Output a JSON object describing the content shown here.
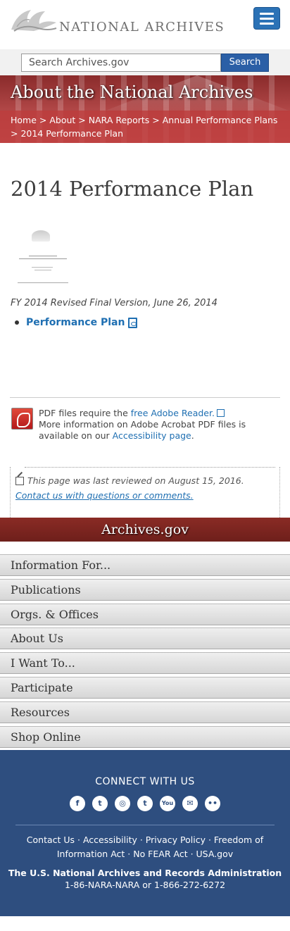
{
  "header": {
    "logo_text": "NATIONAL ARCHIVES",
    "menu_label": "Menu"
  },
  "search": {
    "placeholder": "Search Archives.gov",
    "button": "Search"
  },
  "banner": {
    "title": "About the National Archives",
    "breadcrumbs": [
      "Home",
      "About",
      "NARA Reports",
      "Annual Performance Plans",
      "2014 Performance Plan"
    ]
  },
  "main": {
    "title": "2014 Performance Plan",
    "caption": "FY 2014 Revised Final Version, June 26, 2014",
    "link_label": "Performance Plan"
  },
  "adobe": {
    "text1": "PDF files require the ",
    "link1": "free Adobe Reader.",
    "text2": "More information on Adobe Acrobat PDF files is available on our ",
    "link2": "Accessibility page",
    "text3": "."
  },
  "review": {
    "reviewed": "This page was last reviewed on August 15, 2016.",
    "contact": "Contact us with questions or comments."
  },
  "site_bar": "Archives.gov",
  "nav": [
    "Information For...",
    "Publications",
    "Orgs. & Offices",
    "About Us",
    "I Want To...",
    "Participate",
    "Resources",
    "Shop Online"
  ],
  "footer": {
    "connect": "CONNECT WITH US",
    "social": [
      "f",
      "t",
      "◎",
      "t",
      "You",
      "✉",
      "••"
    ],
    "links": "Contact Us · Accessibility · Privacy Policy · Freedom of Information Act · No FEAR Act · USA.gov",
    "org": "The U.S. National Archives and Records Administration",
    "phone": "1-86-NARA-NARA or 1-866-272-6272"
  }
}
